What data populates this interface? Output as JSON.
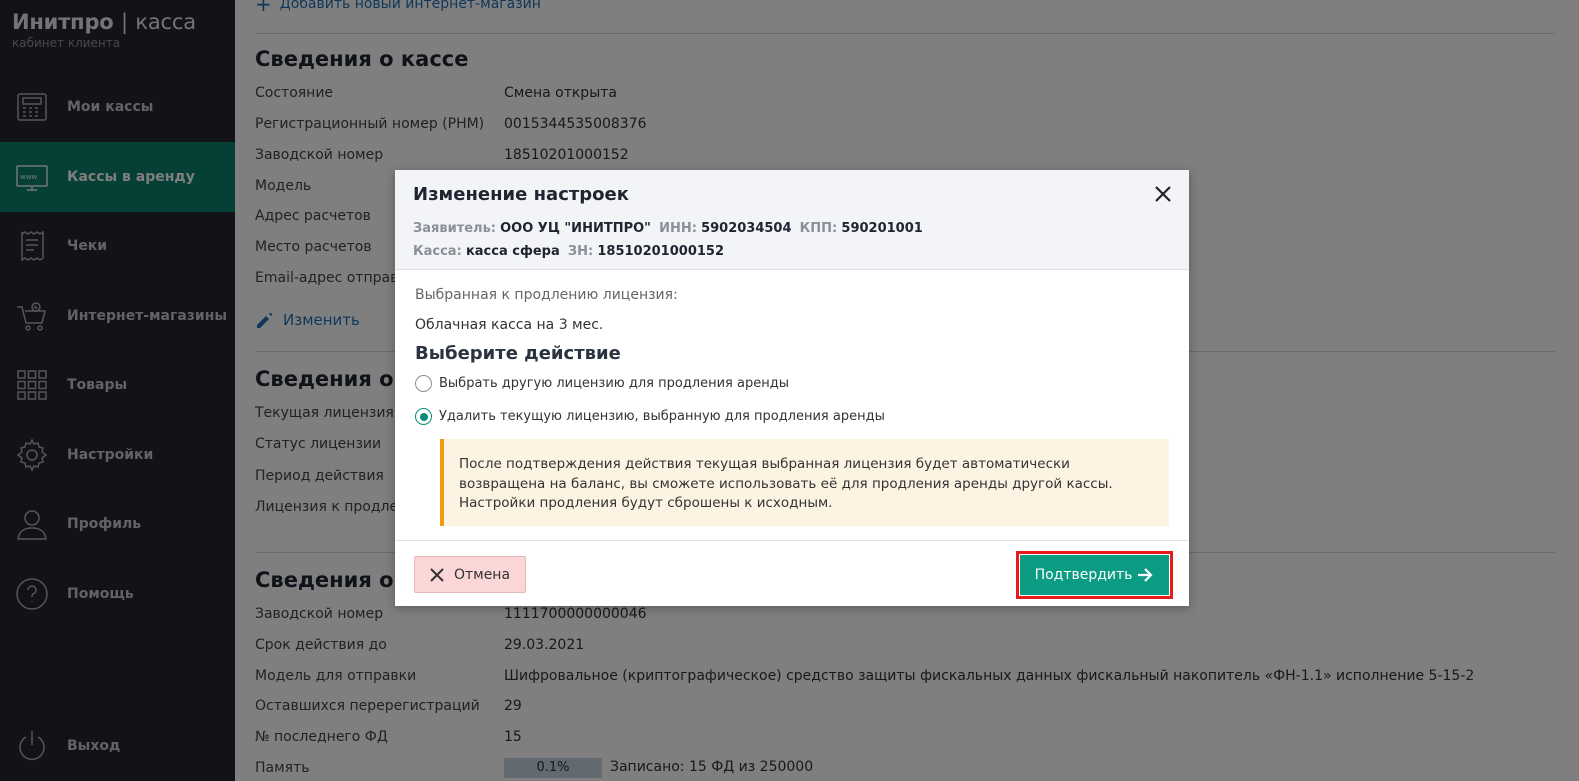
{
  "brand": {
    "name_bold": "Инитпро",
    "separator": "|",
    "name_light": "касса",
    "subtitle": "кабинет клиента"
  },
  "sidebar": {
    "items": [
      {
        "label": "Мои кассы",
        "icon": "cash-register-icon"
      },
      {
        "label": "Кассы в аренду",
        "icon": "www-monitor-icon",
        "active": true
      },
      {
        "label": "Чеки",
        "icon": "receipt-icon"
      },
      {
        "label": "Интернет-магазины",
        "icon": "shopping-cart-icon"
      },
      {
        "label": "Товары",
        "icon": "grid-icon"
      },
      {
        "label": "Настройки",
        "icon": "gear-icon"
      },
      {
        "label": "Профиль",
        "icon": "user-icon"
      },
      {
        "label": "Помощь",
        "icon": "help-icon"
      },
      {
        "label": "Выход",
        "icon": "power-icon"
      }
    ]
  },
  "content": {
    "add_shop_link": "Добавить новый интернет-магазин",
    "cash_info": {
      "title": "Сведения о кассе",
      "rows": [
        {
          "label": "Состояние",
          "value": "Смена открыта"
        },
        {
          "label": "Регистрационный номер (РНМ)",
          "value": "0015344535008376"
        },
        {
          "label": "Заводской номер",
          "value": "18510201000152"
        },
        {
          "label": "Модель",
          "value": ""
        },
        {
          "label": "Адрес расчетов",
          "value": ""
        },
        {
          "label": "Место расчетов",
          "value": ""
        },
        {
          "label": "Email-адрес отправи",
          "value": ""
        }
      ],
      "edit_link": "Изменить"
    },
    "license_info": {
      "title": "Сведения о л",
      "rows": [
        {
          "label": "Текущая лицензия"
        },
        {
          "label": "Статус лицензии"
        },
        {
          "label": "Период действия"
        },
        {
          "label": "Лицензия к продлен"
        }
      ]
    },
    "fn_info": {
      "title": "Сведения о ф",
      "rows": [
        {
          "label": "Заводской номер",
          "value": "1111700000000046"
        },
        {
          "label": "Срок действия до",
          "value": "29.03.2021"
        },
        {
          "label": "Модель для отправки",
          "value": "Шифровальное (криптографическое) средство защиты фискальных данных фискальный накопитель «ФН-1.1» исполнение 5-15-2"
        },
        {
          "label": "Оставшихся перерегистраций",
          "value": "29"
        },
        {
          "label": "№ последнего ФД",
          "value": "15"
        },
        {
          "label": "Память",
          "value": ""
        }
      ],
      "memory_percent": "0.1%",
      "memory_text": "Записано: 15 ФД из 250000"
    }
  },
  "modal": {
    "title": "Изменение настроек",
    "applicant_label": "Заявитель:",
    "applicant_value": "ООО УЦ \"ИНИТПРО\"",
    "inn_label": "ИНН:",
    "inn_value": "5902034504",
    "kpp_label": "КПП:",
    "kpp_value": "590201001",
    "kassa_label": "Касса:",
    "kassa_value": "касса сфера",
    "zn_label": "ЗН:",
    "zn_value": "18510201000152",
    "selected_license_label": "Выбранная к продлению лицензия:",
    "selected_license_value": "Облачная касса на 3 мес.",
    "choose_action": "Выберите действие",
    "options": [
      {
        "label": "Выбрать другую лицензию для продления аренды",
        "checked": false
      },
      {
        "label": "Удалить текущую лицензию, выбранную для продления аренды",
        "checked": true
      }
    ],
    "notice": "После подтверждения действия текущая выбранная лицензия будет автоматически возвращена на баланс, вы сможете использовать её для продления аренды другой кассы. Настройки продления будут сброшены к исходным.",
    "cancel_label": "Отмена",
    "confirm_label": "Подтвердить"
  },
  "colors": {
    "accent": "#0c9c84",
    "sidebar": "#22262e",
    "active_nav": "#0c7f6c",
    "highlight": "#e81a1a",
    "notice_border": "#f29b11"
  }
}
